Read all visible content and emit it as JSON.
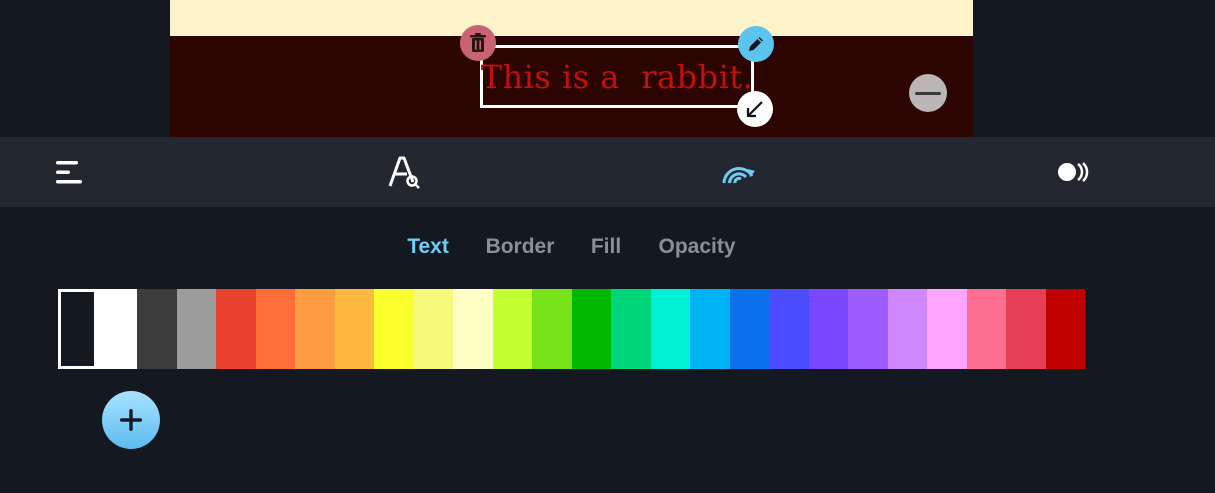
{
  "canvas": {
    "text": "This is a  rabbit.",
    "text_color": "#c20f0f",
    "background_color": "#2c0502",
    "top_band_color": "#fdf3cb"
  },
  "handles": {
    "delete_icon": "trash-icon",
    "edit_icon": "pencil-icon",
    "resize_icon": "resize-arrow-icon",
    "collapse_icon": "minus-icon"
  },
  "toolbar": {
    "items": [
      {
        "name": "menu",
        "icon": "hamburger-menu-icon"
      },
      {
        "name": "font",
        "icon": "font-search-icon"
      },
      {
        "name": "color",
        "icon": "rainbow-icon",
        "active": true
      },
      {
        "name": "effects",
        "icon": "toggle-effects-icon"
      }
    ],
    "active_color": "#6ecdf4"
  },
  "tabs": [
    {
      "label": "Text",
      "active": true
    },
    {
      "label": "Border",
      "active": false
    },
    {
      "label": "Fill",
      "active": false
    },
    {
      "label": "Opacity",
      "active": false
    }
  ],
  "palette": {
    "selected": "transparent",
    "colors": [
      "#3c3c3c",
      "#9c9c9c",
      "#e94330",
      "#ff6e3a",
      "#ff9c42",
      "#ffb840",
      "#fbff2e",
      "#f6f97a",
      "#fdffc4",
      "#c2ff31",
      "#77e31b",
      "#00b800",
      "#00d77a",
      "#00f2d6",
      "#00b3f5",
      "#0c72ec",
      "#4a4dff",
      "#7847ff",
      "#9c5cff",
      "#d187ff",
      "#ffa4ff",
      "#ff6f91",
      "#e63e56",
      "#c10000"
    ]
  },
  "add_button": {
    "icon": "plus-icon"
  }
}
